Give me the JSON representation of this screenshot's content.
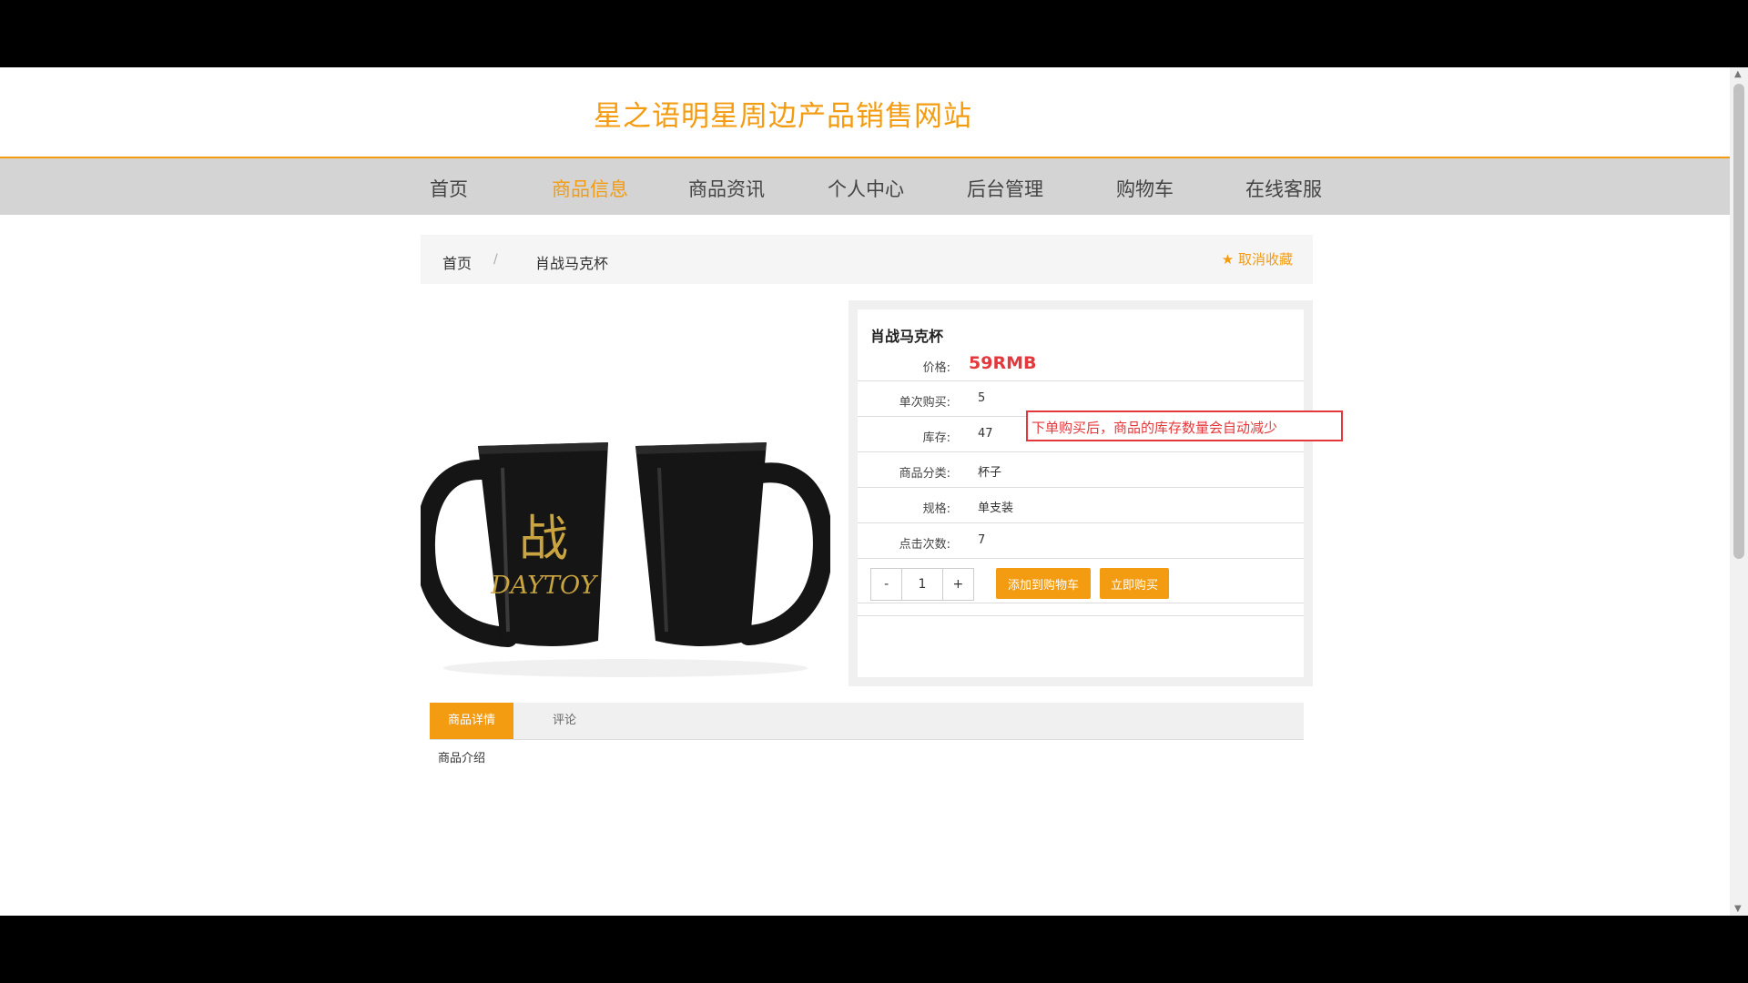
{
  "site": {
    "title": "星之语明星周边产品销售网站"
  },
  "nav": {
    "items": [
      {
        "label": "首页"
      },
      {
        "label": "商品信息",
        "active": true
      },
      {
        "label": "商品资讯"
      },
      {
        "label": "个人中心"
      },
      {
        "label": "后台管理"
      },
      {
        "label": "购物车"
      },
      {
        "label": "在线客服"
      }
    ]
  },
  "breadcrumb": {
    "home": "首页",
    "separator": "/",
    "current": "肖战马克杯"
  },
  "favorite": {
    "icon": "star-icon",
    "label": "取消收藏"
  },
  "product": {
    "name": "肖战马克杯",
    "price_label": "价格:",
    "price": "59RMB",
    "rows": [
      {
        "label": "单次购买:",
        "value": "5"
      },
      {
        "label": "库存:",
        "value": "47"
      },
      {
        "label": "商品分类:",
        "value": "杯子"
      },
      {
        "label": "规格:",
        "value": "单支装"
      },
      {
        "label": "点击次数:",
        "value": "7"
      }
    ],
    "image_text": {
      "glyph": "战",
      "brand": "DAYTOY"
    }
  },
  "stepper": {
    "minus": "-",
    "qty": "1",
    "plus": "+"
  },
  "buttons": {
    "add_to_cart": "添加到购物车",
    "buy_now": "立即购买"
  },
  "annotation": {
    "text": "下单购买后，商品的库存数量会自动减少"
  },
  "tabs": {
    "detail": "商品详情",
    "comments": "评论"
  },
  "detail": {
    "intro": "商品介绍"
  },
  "colors": {
    "accent": "#f39c12",
    "price": "#e4393c",
    "nav_bg": "#d4d4d4"
  }
}
